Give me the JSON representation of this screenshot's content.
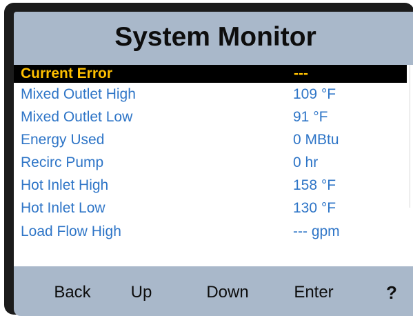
{
  "header": {
    "title": "System Monitor"
  },
  "list": {
    "items": [
      {
        "label": "Current Error",
        "value": "---",
        "selected": true
      },
      {
        "label": "Mixed Outlet High",
        "value": "109 °F"
      },
      {
        "label": "Mixed Outlet Low",
        "value": "91 °F"
      },
      {
        "label": "Energy Used",
        "value": "0 MBtu"
      },
      {
        "label": "Recirc Pump",
        "value": "0 hr"
      },
      {
        "label": "Hot Inlet High",
        "value": "158 °F"
      },
      {
        "label": "Hot Inlet Low",
        "value": "130 °F"
      },
      {
        "label": "Load Flow High",
        "value": "--- gpm"
      }
    ]
  },
  "softkeys": {
    "back": "Back",
    "up": "Up",
    "down": "Down",
    "enter": "Enter",
    "help": "?"
  },
  "colors": {
    "screen_background": "#a9b8ca",
    "list_text": "#2e75c7",
    "selected_background": "#000000",
    "selected_text": "#ffc000",
    "bezel": "#1b1b1b"
  }
}
